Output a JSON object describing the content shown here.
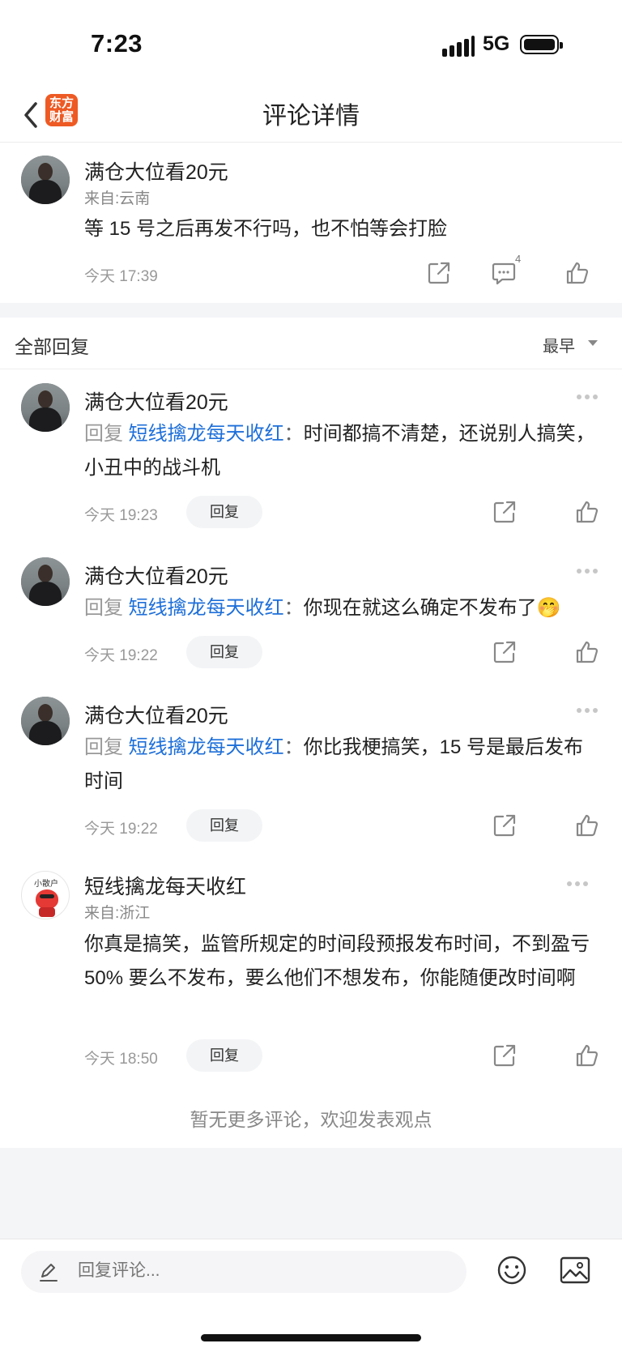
{
  "status_bar": {
    "time": "7:23",
    "network": "5G"
  },
  "nav": {
    "logo_text": "东方财富",
    "title": "评论详情"
  },
  "main_comment": {
    "username": "满仓大位看20元",
    "location": "来自:云南",
    "content": "等 15 号之后再发不行吗，也不怕等会打脸",
    "time": "今天 17:39",
    "comment_count": "4"
  },
  "replies_header": {
    "title": "全部回复",
    "sort_label": "最早"
  },
  "reply_prefix": "回复",
  "reply_button_label": "回复",
  "replies": [
    {
      "username": "满仓大位看20元",
      "target": "短线擒龙每天收红",
      "colon": "：",
      "text": "时间都搞不清楚，还说别人搞笑，小丑中的战斗机",
      "time": "今天 19:23"
    },
    {
      "username": "满仓大位看20元",
      "target": "短线擒龙每天收红",
      "colon": "：",
      "text": "你现在就这么确定不发布了🤭",
      "time": "今天 19:22"
    },
    {
      "username": "满仓大位看20元",
      "target": "短线擒龙每天收红",
      "colon": "：",
      "text": "你比我梗搞笑，15 号是最后发布时间",
      "time": "今天 19:22"
    },
    {
      "username": "短线擒龙每天收红",
      "avatar_tag": "小散户",
      "location": "来自:浙江",
      "text": "你真是搞笑，监管所规定的时间段预报发布时间，不到盈亏 50% 要么不发布，要么他们不想发布，你能随便改时间啊",
      "time": "今天 18:50"
    }
  ],
  "footer_note": "暂无更多评论，欢迎发表观点",
  "input": {
    "placeholder": "回复评论..."
  },
  "icons": {
    "back": "chevron-left-icon",
    "share": "share-icon",
    "comment": "comment-icon",
    "like": "thumbs-up-icon",
    "more": "more-dots-icon",
    "edit": "pencil-icon",
    "emoji": "emoji-icon",
    "image": "image-icon"
  }
}
